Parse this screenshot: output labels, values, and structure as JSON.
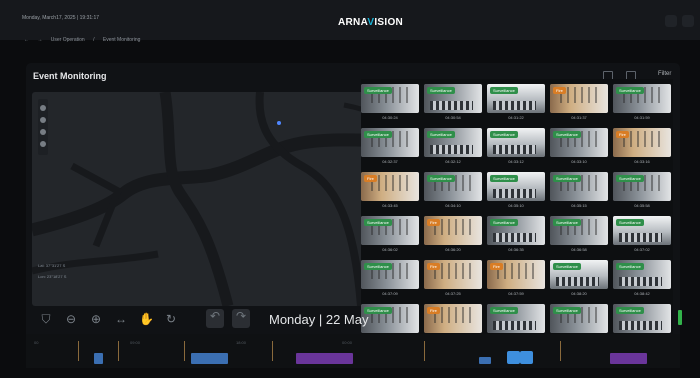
{
  "topbar": {
    "datetime": "Monday, March17, 2025 | 19:31:17",
    "logo_prefix": "ARNA",
    "logo_accent": "V",
    "logo_suffix": "ISION"
  },
  "breadcrumb": {
    "back": "←",
    "forward": "→",
    "section": "User Operation",
    "separator": "/",
    "page": "Event Monitoring"
  },
  "panel": {
    "title": "Event Monitoring",
    "filter_label": "Filter"
  },
  "map": {
    "coord_lat": "Lat: 37°31'27 S",
    "coord_lon": "Lon: 23°18'27 S"
  },
  "gallery": {
    "items": [
      {
        "label": "Surveillance",
        "time": "04:30:24",
        "tone": "green",
        "type": "light"
      },
      {
        "label": "Surveillance",
        "time": "04:30:54",
        "tone": "green",
        "type": "crowd"
      },
      {
        "label": "Surveillance",
        "time": "04:31:22",
        "tone": "green",
        "type": "glass"
      },
      {
        "label": "Fire",
        "time": "04:31:37",
        "tone": "orange",
        "type": "hall"
      },
      {
        "label": "Surveillance",
        "time": "04:31:59",
        "tone": "green",
        "type": "light"
      },
      {
        "label": "Surveillance",
        "time": "04:32:37",
        "tone": "green",
        "type": "light"
      },
      {
        "label": "Surveillance",
        "time": "04:32:12",
        "tone": "green",
        "type": "crowd"
      },
      {
        "label": "Surveillance",
        "time": "04:33:12",
        "tone": "green",
        "type": "glass"
      },
      {
        "label": "Surveillance",
        "time": "04:33:10",
        "tone": "green",
        "type": "light"
      },
      {
        "label": "Fire",
        "time": "04:33:16",
        "tone": "orange",
        "type": "hall"
      },
      {
        "label": "Fire",
        "time": "04:33:45",
        "tone": "orange",
        "type": "hall"
      },
      {
        "label": "Surveillance",
        "time": "04:34:10",
        "tone": "green",
        "type": "light"
      },
      {
        "label": "Surveillance",
        "time": "04:35:10",
        "tone": "green",
        "type": "glass"
      },
      {
        "label": "Surveillance",
        "time": "04:35:15",
        "tone": "green",
        "type": "light"
      },
      {
        "label": "Surveillance",
        "time": "04:35:58",
        "tone": "green",
        "type": "light"
      },
      {
        "label": "Surveillance",
        "time": "04:36:02",
        "tone": "green",
        "type": "light"
      },
      {
        "label": "Fire",
        "time": "04:36:20",
        "tone": "orange",
        "type": "hall"
      },
      {
        "label": "Surveillance",
        "time": "04:36:35",
        "tone": "green",
        "type": "crowd"
      },
      {
        "label": "Surveillance",
        "time": "04:36:58",
        "tone": "green",
        "type": "light"
      },
      {
        "label": "Surveillance",
        "time": "04:37:02",
        "tone": "green",
        "type": "glass"
      },
      {
        "label": "Surveillance",
        "time": "04:37:09",
        "tone": "green",
        "type": "light"
      },
      {
        "label": "Fire",
        "time": "04:37:25",
        "tone": "orange",
        "type": "hall"
      },
      {
        "label": "Fire",
        "time": "04:37:59",
        "tone": "orange",
        "type": "hall"
      },
      {
        "label": "Surveillance",
        "time": "04:38:20",
        "tone": "green",
        "type": "glass"
      },
      {
        "label": "Surveillance",
        "time": "04:38:42",
        "tone": "green",
        "type": "crowd"
      },
      {
        "label": "Surveillance",
        "time": "04:39:20",
        "tone": "green",
        "type": "light"
      },
      {
        "label": "Fire",
        "time": "04:39:38",
        "tone": "orange",
        "type": "hall"
      },
      {
        "label": "Surveillance",
        "time": "04:39:41",
        "tone": "green",
        "type": "crowd"
      },
      {
        "label": "Surveillance",
        "time": "04:39:56",
        "tone": "green",
        "type": "light"
      },
      {
        "label": "Surveillance",
        "time": "04:40:00",
        "tone": "green",
        "type": "crowd"
      }
    ]
  },
  "player": {
    "date": "Monday | 22 May",
    "controls": [
      {
        "name": "bucket-icon",
        "glyph": "⛉"
      },
      {
        "name": "zoom-out-icon",
        "glyph": "⊖"
      },
      {
        "name": "zoom-in-icon",
        "glyph": "⊕"
      },
      {
        "name": "fit-width-icon",
        "glyph": "↔"
      },
      {
        "name": "hand-icon",
        "glyph": "✋"
      },
      {
        "name": "refresh-icon",
        "glyph": "↻"
      },
      {
        "name": "undo-icon",
        "glyph": "↶"
      },
      {
        "name": "redo-icon",
        "glyph": "↷"
      }
    ]
  },
  "timeline": {
    "ticks": [
      "00",
      "09:00",
      "18:00",
      "00:00"
    ]
  },
  "colors": {
    "background": "#0b0c0e",
    "panel": "#101215",
    "accent": "#18b4d8",
    "surveillance_badge": "#2f8f4a",
    "fire_badge": "#d97d25",
    "event_blue": "#3b6fb2",
    "event_purple": "#6a359a"
  }
}
